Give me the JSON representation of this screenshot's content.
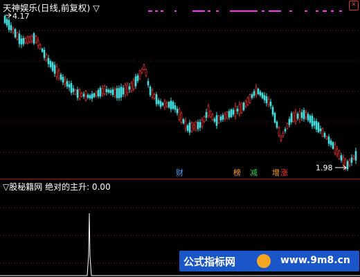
{
  "main": {
    "title": "天神娱乐(日线,前复权) ▽",
    "last_close": "4.17",
    "low_price": "1.98",
    "markers": [
      {
        "label": "财",
        "color": "#4aa3ff"
      },
      {
        "label": "榜",
        "color": "#ff9f2a"
      },
      {
        "label": "减",
        "color": "#3ad24a"
      },
      {
        "label": "增",
        "color": "#ff9f2a"
      },
      {
        "label": "涨",
        "color": "#ff3333"
      }
    ],
    "up_color": "#ff3b3b",
    "down_color": "#42e0e0"
  },
  "sub": {
    "title": "▽股秘籍网",
    "indicator": "绝对的主升",
    "value": ": 0.00",
    "line_color": "#ffffff"
  },
  "window": {
    "close_icon": "close-icon",
    "close_glyph": "✕"
  },
  "watermark": {
    "left_text": "公式指标网",
    "right_text": "www.9m8.cn",
    "badge_color": "#f5a623"
  }
}
